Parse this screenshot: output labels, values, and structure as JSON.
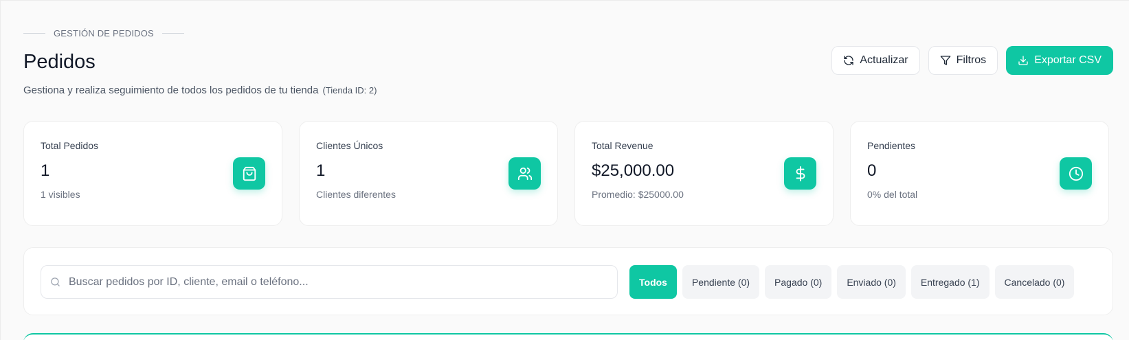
{
  "header": {
    "eyebrow": "GESTIÓN DE PEDIDOS",
    "title": "Pedidos",
    "subtitle": "Gestiona y realiza seguimiento de todos los pedidos de tu tienda",
    "store_id": "(Tienda ID: 2)"
  },
  "actions": {
    "refresh_label": "Actualizar",
    "filters_label": "Filtros",
    "export_label": "Exportar CSV"
  },
  "stats": [
    {
      "label": "Total Pedidos",
      "value": "1",
      "note": "1 visibles",
      "icon": "shopping-bag-icon"
    },
    {
      "label": "Clientes Únicos",
      "value": "1",
      "note": "Clientes diferentes",
      "icon": "users-icon"
    },
    {
      "label": "Total Revenue",
      "value": "$25,000.00",
      "note": "Promedio: $25000.00",
      "icon": "dollar-icon"
    },
    {
      "label": "Pendientes",
      "value": "0",
      "note": "0% del total",
      "icon": "clock-icon"
    }
  ],
  "search": {
    "placeholder": "Buscar pedidos por ID, cliente, email o teléfono...",
    "value": ""
  },
  "status_tabs": [
    {
      "label": "Todos",
      "active": true
    },
    {
      "label": "Pendiente (0)",
      "active": false
    },
    {
      "label": "Pagado (0)",
      "active": false
    },
    {
      "label": "Enviado (0)",
      "active": false
    },
    {
      "label": "Entregado (1)",
      "active": false
    },
    {
      "label": "Cancelado (0)",
      "active": false
    }
  ],
  "colors": {
    "accent": "#0fc7a3",
    "background": "#fafafa",
    "text": "#111827"
  }
}
